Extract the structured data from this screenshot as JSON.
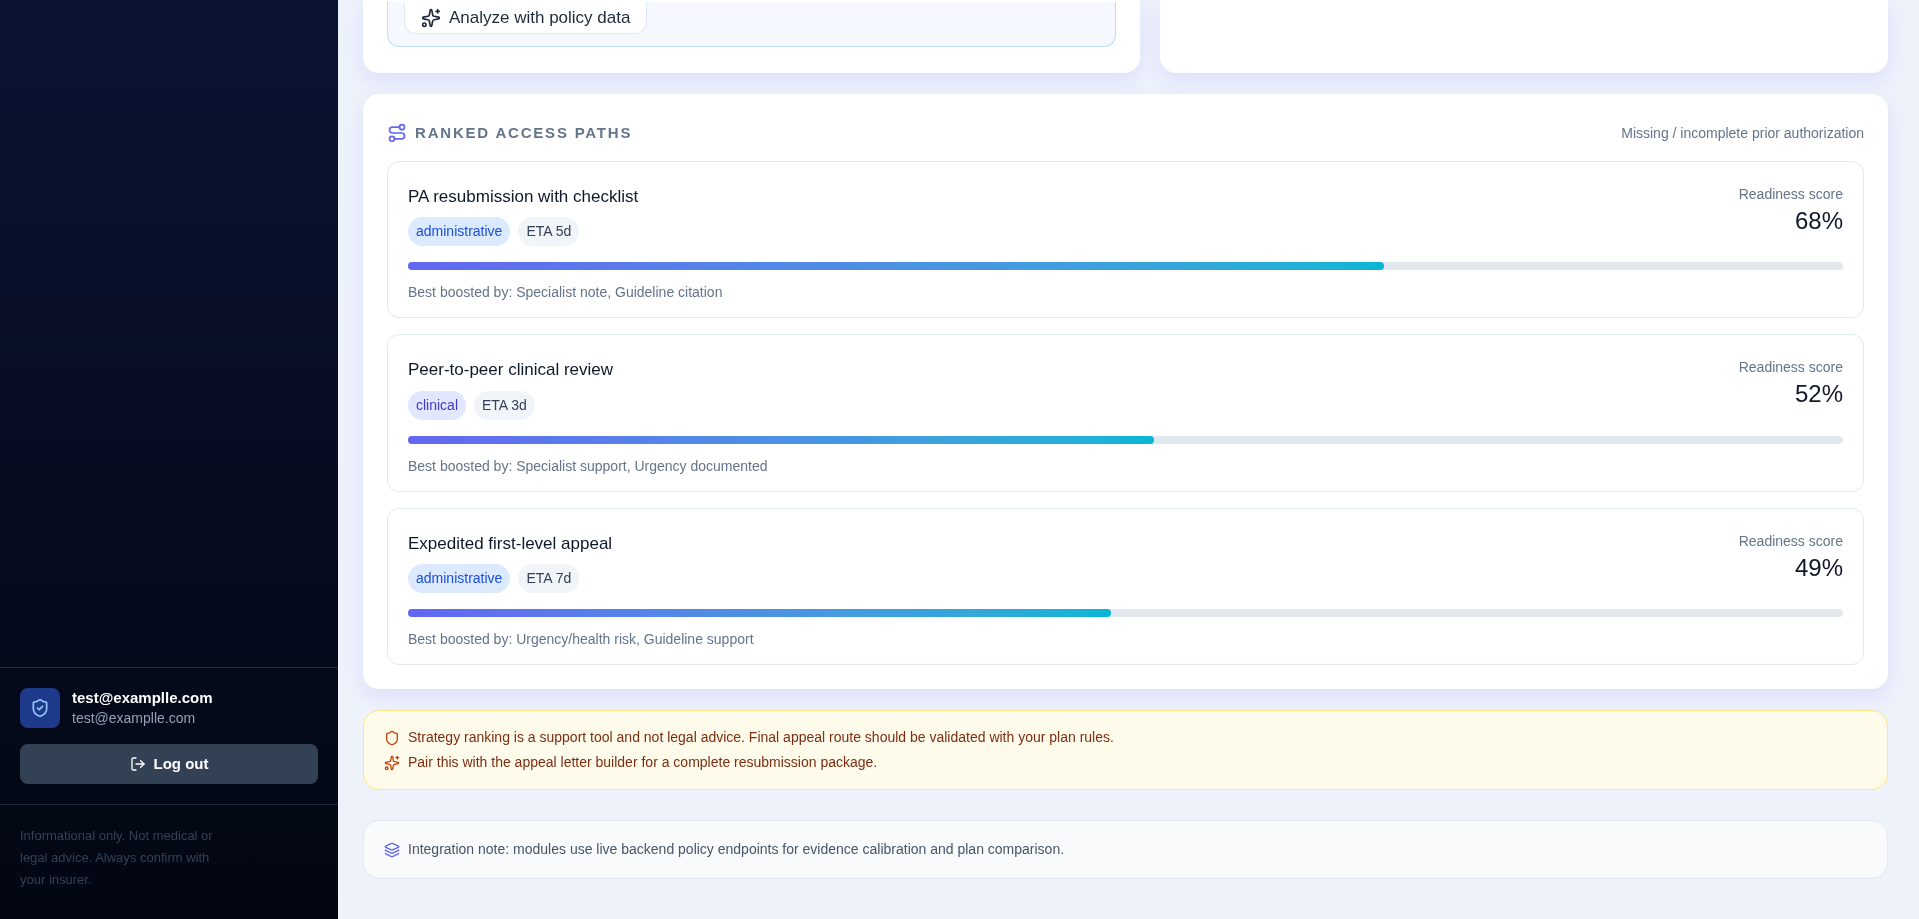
{
  "sidebar": {
    "user": {
      "name": "test@examplle.com",
      "email": "test@examplle.com"
    },
    "logout_button": "Log out",
    "disclaimer": "Informational only. Not medical or legal advice. Always confirm with your insurer."
  },
  "analyze_button": "Analyze with policy data",
  "ranked_paths": {
    "title": "RANKED ACCESS PATHS",
    "context": "Missing / incomplete prior authorization",
    "items": [
      {
        "title": "PA resubmission with checklist",
        "tag": {
          "label": "administrative",
          "kind": "administrative"
        },
        "eta": "ETA 5d",
        "score_label": "Readiness score",
        "score": "68%",
        "level": 0.68,
        "boosted_by": "Best boosted by: Specialist note, Guideline citation"
      },
      {
        "title": "Peer-to-peer clinical review",
        "tag": {
          "label": "clinical",
          "kind": "clinical"
        },
        "eta": "ETA 3d",
        "score_label": "Readiness score",
        "score": "52%",
        "level": 0.52,
        "boosted_by": "Best boosted by: Specialist support, Urgency documented"
      },
      {
        "title": "Expedited first-level appeal",
        "tag": {
          "label": "administrative",
          "kind": "administrative"
        },
        "eta": "ETA 7d",
        "score_label": "Readiness score",
        "score": "49%",
        "level": 0.49,
        "boosted_by": "Best boosted by: Urgency/health risk, Guideline support"
      }
    ]
  },
  "notice": [
    "Strategy ranking is a support tool and not legal advice. Final appeal route should be validated with your plan rules.",
    "Pair this with the appeal letter builder for a complete resubmission package."
  ],
  "integration_note": "Integration note: modules use live backend policy endpoints for evidence calibration and plan comparison."
}
